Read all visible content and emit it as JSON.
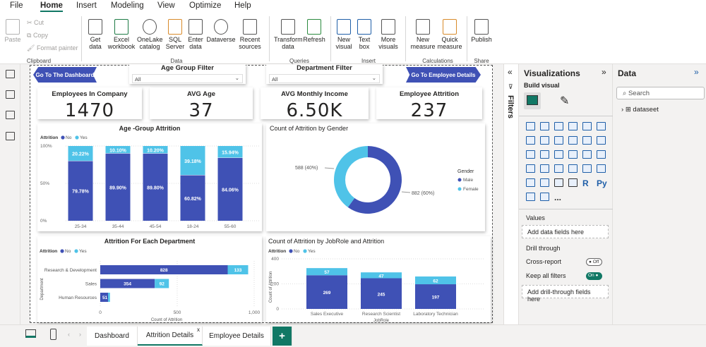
{
  "menu": {
    "tabs": [
      "File",
      "Home",
      "Insert",
      "Modeling",
      "View",
      "Optimize",
      "Help"
    ],
    "active": "Home"
  },
  "ribbon": {
    "clipboard": {
      "paste": "Paste",
      "cut": "Cut",
      "copy": "Copy",
      "format_painter": "Format painter",
      "group": "Clipboard"
    },
    "data": {
      "get_data": "Get data",
      "excel": "Excel workbook",
      "onelake": "OneLake catalog",
      "sql": "SQL Server",
      "enter": "Enter data",
      "dataverse": "Dataverse",
      "recent": "Recent sources",
      "group": "Data"
    },
    "queries": {
      "transform": "Transform data",
      "refresh": "Refresh",
      "group": "Queries"
    },
    "insert": {
      "new_visual": "New visual",
      "text_box": "Text box",
      "more_visuals": "More visuals",
      "group": "Insert"
    },
    "calculations": {
      "new_measure": "New measure",
      "quick_measure": "Quick measure",
      "group": "Calculations"
    },
    "share": {
      "publish": "Publish",
      "group": "Share"
    }
  },
  "report": {
    "nav_left": "Go To The Dashboard",
    "nav_right": "Go To Employee Details",
    "slicers": [
      {
        "title": "Age Group Filter",
        "value": "All"
      },
      {
        "title": "Department Filter",
        "value": "All"
      }
    ],
    "kpis": [
      {
        "title": "Employees In Company",
        "value": "1470"
      },
      {
        "title": "AVG Age",
        "value": "37"
      },
      {
        "title": "AVG Monthly Income",
        "value": "6.50K"
      },
      {
        "title": "Employee Attrition",
        "value": "237"
      }
    ]
  },
  "colors": {
    "no": "#3f51b5",
    "yes": "#4fc3e8",
    "accent": "#117865"
  },
  "chart_data": [
    {
      "type": "bar",
      "stacked": "100%",
      "title": "Age -Group Attrition",
      "legend_title": "Attrition",
      "categories": [
        "25-34",
        "35-44",
        "45-54",
        "18-24",
        "55-60"
      ],
      "series": [
        {
          "name": "No",
          "values": [
            79.78,
            89.9,
            89.8,
            60.82,
            84.06
          ],
          "labels": [
            "79.78%",
            "89.90%",
            "89.80%",
            "60.82%",
            "84.06%"
          ]
        },
        {
          "name": "Yes",
          "values": [
            20.22,
            10.1,
            10.2,
            39.18,
            15.94
          ],
          "labels": [
            "20.22%",
            "10.10%",
            "10.20%",
            "39.18%",
            "15.94%"
          ]
        }
      ],
      "yticks": [
        "0%",
        "50%",
        "100%"
      ],
      "ylim": [
        0,
        100
      ]
    },
    {
      "type": "pie",
      "donut": true,
      "title": "Count of Attrition by Gender",
      "legend_title": "Gender",
      "categories": [
        "Male",
        "Female"
      ],
      "values": [
        882,
        588
      ],
      "labels": [
        "882 (60%)",
        "588 (40%)"
      ],
      "legend": "right"
    },
    {
      "type": "bar",
      "orientation": "horizontal",
      "stacked": true,
      "title": "Attrition For Each Department",
      "legend_title": "Attrition",
      "categories": [
        "Research & Development",
        "Sales",
        "Human Resources"
      ],
      "series": [
        {
          "name": "No",
          "values": [
            828,
            354,
            51
          ]
        },
        {
          "name": "Yes",
          "values": [
            133,
            92,
            12
          ]
        }
      ],
      "xlabel": "Count of Attrition",
      "ylabel": "Department",
      "xticks": [
        "0",
        "500",
        "1,000"
      ],
      "xlim": [
        0,
        1000
      ]
    },
    {
      "type": "bar",
      "stacked": true,
      "title": "Count of Attrition by JobRole and Attrition",
      "legend_title": "Attrition",
      "categories": [
        "Sales Executive",
        "Research Scientist",
        "Laboratory Technician"
      ],
      "series": [
        {
          "name": "No",
          "values": [
            269,
            245,
            197
          ]
        },
        {
          "name": "Yes",
          "values": [
            57,
            47,
            62
          ]
        }
      ],
      "xlabel": "JobRole",
      "ylabel": "Count of Attrition",
      "yticks": [
        "0",
        "200",
        "400"
      ],
      "ylim": [
        0,
        400
      ]
    }
  ],
  "filters_pane": {
    "label": "Filters"
  },
  "visualizations": {
    "title": "Visualizations",
    "build_visual": "Build visual",
    "values_label": "Values",
    "values_placeholder": "Add data fields here",
    "drill_through": "Drill through",
    "cross_report": "Cross-report",
    "cross_report_state": "Off",
    "keep_filters": "Keep all filters",
    "keep_filters_state": "On",
    "drill_placeholder": "Add drill-through fields here",
    "r_label": "R",
    "py_label": "Py",
    "more": "..."
  },
  "data_pane": {
    "title": "Data",
    "search_placeholder": "Search",
    "tables": [
      "dataseet"
    ]
  },
  "pages": {
    "tabs": [
      "Dashboard",
      "Attrition Details",
      "Employee Details"
    ],
    "active": "Attrition Details",
    "add": "+",
    "close": "x"
  }
}
